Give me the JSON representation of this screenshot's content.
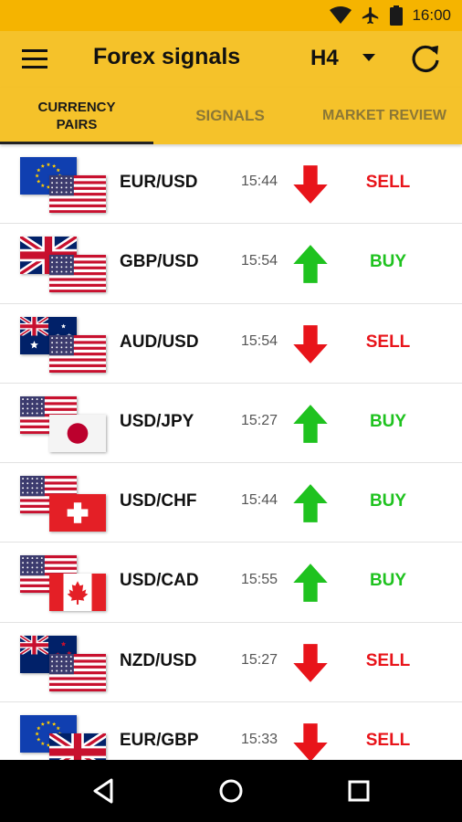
{
  "status_bar": {
    "time": "16:00",
    "icons": [
      "wifi-icon",
      "airplane-icon",
      "battery-icon"
    ]
  },
  "app_bar": {
    "title": "Forex signals",
    "timeframe": "H4",
    "menu_icon": "hamburger-menu-icon",
    "dropdown_icon": "dropdown-arrow-icon",
    "refresh_icon": "refresh-icon"
  },
  "tabs": [
    {
      "label": "CURRENCY PAIRS",
      "active": true
    },
    {
      "label": "SIGNALS",
      "active": false
    },
    {
      "label": "MARKET REVIEW",
      "active": false
    }
  ],
  "colors": {
    "status_bar": "#f5b400",
    "app_bar": "#f5c22a",
    "sell": "#e8141a",
    "buy": "#1fc21f"
  },
  "pairs": [
    {
      "pair": "EUR/USD",
      "time": "15:44",
      "signal": "SELL",
      "direction": "down",
      "base_flag": "eu",
      "quote_flag": "us"
    },
    {
      "pair": "GBP/USD",
      "time": "15:54",
      "signal": "BUY",
      "direction": "up",
      "base_flag": "gb",
      "quote_flag": "us"
    },
    {
      "pair": "AUD/USD",
      "time": "15:54",
      "signal": "SELL",
      "direction": "down",
      "base_flag": "au",
      "quote_flag": "us"
    },
    {
      "pair": "USD/JPY",
      "time": "15:27",
      "signal": "BUY",
      "direction": "up",
      "base_flag": "us",
      "quote_flag": "jp"
    },
    {
      "pair": "USD/CHF",
      "time": "15:44",
      "signal": "BUY",
      "direction": "up",
      "base_flag": "us",
      "quote_flag": "ch"
    },
    {
      "pair": "USD/CAD",
      "time": "15:55",
      "signal": "BUY",
      "direction": "up",
      "base_flag": "us",
      "quote_flag": "ca"
    },
    {
      "pair": "NZD/USD",
      "time": "15:27",
      "signal": "SELL",
      "direction": "down",
      "base_flag": "nz",
      "quote_flag": "us"
    },
    {
      "pair": "EUR/GBP",
      "time": "15:33",
      "signal": "SELL",
      "direction": "down",
      "base_flag": "eu",
      "quote_flag": "gb"
    }
  ],
  "nav_bar": {
    "buttons": [
      "back-icon",
      "home-icon",
      "recents-icon"
    ]
  }
}
